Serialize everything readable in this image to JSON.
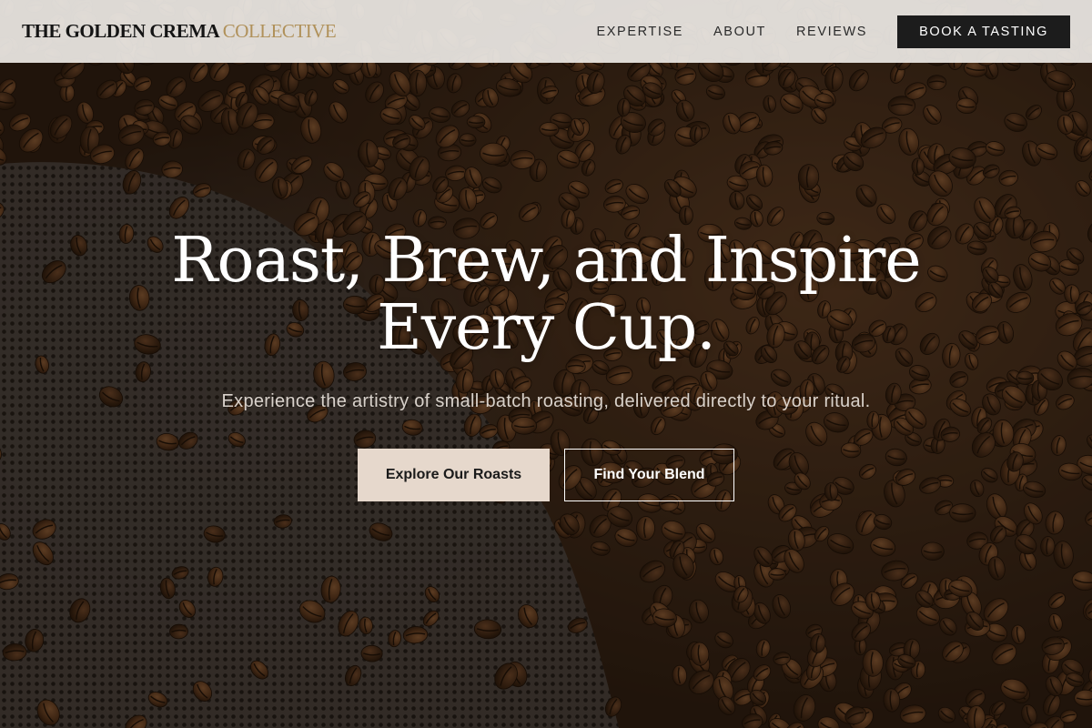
{
  "brand": {
    "name_main": "THE GOLDEN CREMA",
    "name_accent": "COLLECTIVE",
    "accent_color": "#b0915a"
  },
  "nav": {
    "links": [
      {
        "label": "EXPERTISE"
      },
      {
        "label": "ABOUT"
      },
      {
        "label": "REVIEWS"
      }
    ],
    "cta_label": "BOOK A TASTING"
  },
  "hero": {
    "title_line1": "Roast, Brew, and Inspire",
    "title_line2": "Every Cup.",
    "subtitle": "Experience the artistry of small-batch roasting, delivered directly to your ritual.",
    "primary_button": "Explore Our Roasts",
    "secondary_button": "Find Your Blend",
    "background_image": "coffee-beans-roaster-photo"
  },
  "colors": {
    "header_bg": "#ece8e4",
    "cta_bg": "#1c1c1c",
    "primary_button_bg": "#e6d8cc"
  }
}
